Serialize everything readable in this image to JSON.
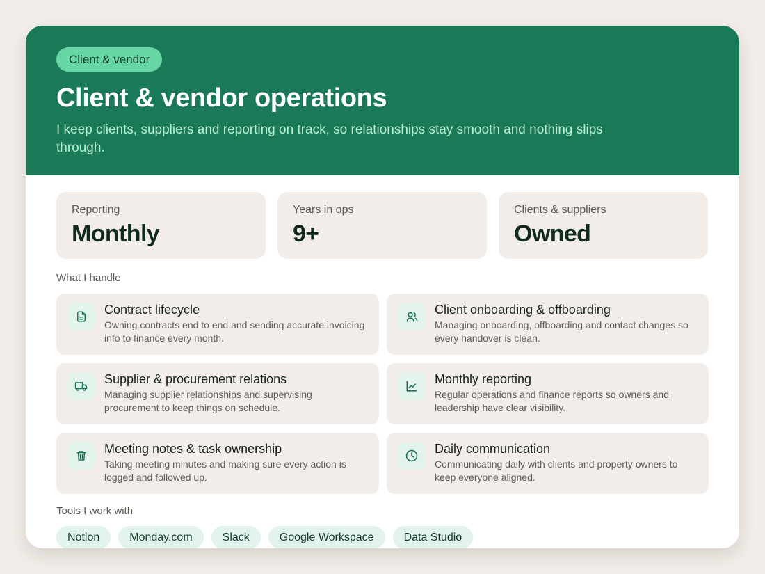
{
  "header": {
    "badge": "Client & vendor",
    "title": "Client & vendor operations",
    "subtitle": "I keep clients, suppliers and reporting on track, so relationships stay smooth and nothing slips through."
  },
  "stats": [
    {
      "label": "Reporting",
      "value": "Monthly"
    },
    {
      "label": "Years in ops",
      "value": "9+"
    },
    {
      "label": "Clients & suppliers",
      "value": "Owned"
    }
  ],
  "handle": {
    "label": "What I handle",
    "items": [
      {
        "icon": "document-icon",
        "title": "Contract lifecycle",
        "desc": "Owning contracts end to end and sending accurate invoicing info to finance every month."
      },
      {
        "icon": "users-icon",
        "title": "Client onboarding & offboarding",
        "desc": "Managing onboarding, offboarding and contact changes so every handover is clean."
      },
      {
        "icon": "truck-icon",
        "title": "Supplier & procurement relations",
        "desc": "Managing supplier relationships and supervising procurement to keep things on schedule."
      },
      {
        "icon": "chart-icon",
        "title": "Monthly reporting",
        "desc": "Regular operations and finance reports so owners and leadership have clear visibility."
      },
      {
        "icon": "trash-icon",
        "title": "Meeting notes & task ownership",
        "desc": "Taking meeting minutes and making sure every action is logged and followed up."
      },
      {
        "icon": "clock-icon",
        "title": "Daily communication",
        "desc": "Communicating daily with clients and property owners to keep everyone aligned."
      }
    ]
  },
  "tools": {
    "label": "Tools I work with",
    "items": [
      "Notion",
      "Monday.com",
      "Slack",
      "Google Workspace",
      "Data Studio"
    ]
  },
  "colors": {
    "header_bg": "#1a7a58",
    "badge_bg": "#66d7a4",
    "subtitle": "#b9f0d3",
    "tile_bg": "#f2ede9",
    "icon_bg": "#e1f3ea",
    "icon_stroke": "#17704f"
  }
}
